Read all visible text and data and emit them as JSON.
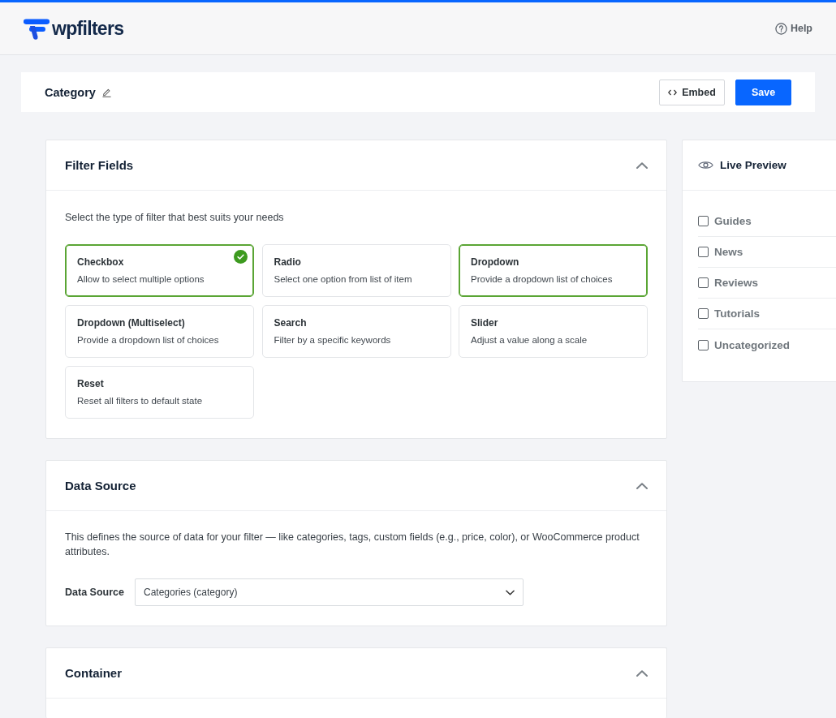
{
  "header": {
    "logo": "wpfilters",
    "help": "Help"
  },
  "title_bar": {
    "title": "Category",
    "buttons": [
      {
        "label": "Embed",
        "kind": "secondary"
      },
      {
        "label": "Save",
        "kind": "primary"
      }
    ]
  },
  "panels": [
    {
      "title": "Filter Fields",
      "expanded": true,
      "kind": "filter_types",
      "description": "Select the type of filter that best suits your needs",
      "options": [
        {
          "title": "Checkbox",
          "description": "Allow to select multiple options",
          "selected": true,
          "highlighted": true
        },
        {
          "title": "Radio",
          "description": "Select one option from list of item",
          "selected": false,
          "highlighted": false
        },
        {
          "title": "Dropdown",
          "description": "Provide a dropdown list of choices",
          "selected": false,
          "highlighted": true
        },
        {
          "title": "Dropdown (Multiselect)",
          "description": "Provide a dropdown list of choices",
          "selected": false,
          "highlighted": false
        },
        {
          "title": "Search",
          "description": "Filter by a specific keywords",
          "selected": false,
          "highlighted": false
        },
        {
          "title": "Slider",
          "description": "Adjust a value along a scale",
          "selected": false,
          "highlighted": false
        },
        {
          "title": "Reset",
          "description": "Reset all filters to default state",
          "selected": false,
          "highlighted": false
        }
      ]
    },
    {
      "title": "Data Source",
      "expanded": true,
      "kind": "data_source",
      "description": "This defines the source of data for your filter — like categories, tags, custom fields (e.g., price, color), or WooCommerce product attributes.",
      "field": {
        "label": "Data Source",
        "value": "Categories (category)"
      }
    },
    {
      "title": "Container",
      "expanded": true,
      "kind": "container"
    }
  ],
  "preview": {
    "title": "Live Preview",
    "items": [
      {
        "label": "Guides",
        "checked": false
      },
      {
        "label": "News",
        "checked": false
      },
      {
        "label": "Reviews",
        "checked": false
      },
      {
        "label": "Tutorials",
        "checked": false
      },
      {
        "label": "Uncategorized",
        "checked": false
      }
    ]
  }
}
